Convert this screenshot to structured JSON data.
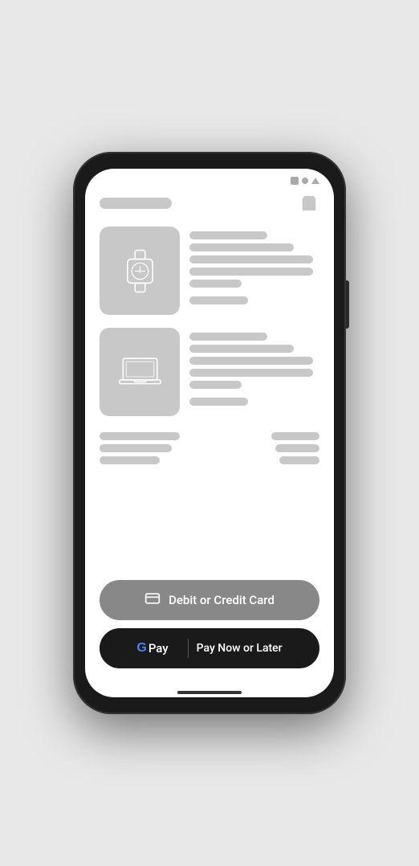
{
  "phone": {
    "status": {
      "icons": [
        "square",
        "circle",
        "triangle"
      ]
    }
  },
  "header": {
    "title_bar": "title",
    "cart_label": "cart"
  },
  "products": [
    {
      "type": "watch",
      "detail_bars": [
        "short",
        "medium",
        "long",
        "long",
        "xshort",
        "price"
      ]
    },
    {
      "type": "laptop",
      "detail_bars": [
        "short",
        "medium",
        "long",
        "long",
        "xshort",
        "price"
      ]
    }
  ],
  "summary": {
    "left_bars": [
      "s1",
      "s2",
      "s3"
    ],
    "right_bars": [
      "s4",
      "s5",
      "s6"
    ]
  },
  "buttons": {
    "card_label": "Debit or Credit Card",
    "gpay_g": "G",
    "gpay_pay": "Pay",
    "gpay_pay_now_later": "Pay Now or Later"
  }
}
